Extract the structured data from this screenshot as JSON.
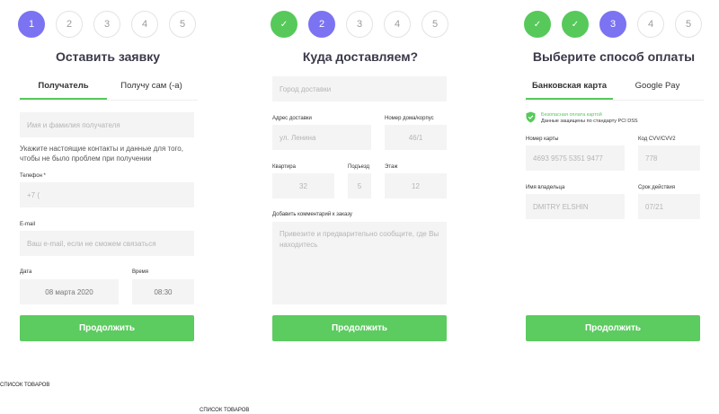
{
  "panels": [
    {
      "steps": [
        "1",
        "2",
        "3",
        "4",
        "5"
      ],
      "title": "Оставить заявку",
      "tabs": [
        "Получатель",
        "Получу сам (-а)"
      ],
      "name_placeholder": "Имя и фамилия получателя",
      "hint": "Укажите настоящие контакты и данные для того, чтобы не было проблем при получении",
      "phone_label": "Телефон *",
      "phone_value": "+7 (",
      "email_label": "E-mail",
      "email_placeholder": "Ваш e-mail, если не сможем связаться",
      "date_label": "Дата",
      "date_value": "08 марта 2020",
      "time_label": "Время",
      "time_value": "08:30",
      "button": "Продолжить"
    },
    {
      "steps": [
        "✓",
        "2",
        "3",
        "4",
        "5"
      ],
      "title": "Куда доставляем?",
      "city_placeholder": "Город доставки",
      "address_label": "Адрес доставки",
      "address_value": "ул. Ленина",
      "house_label": "Номер дома/корпус",
      "house_value": "46/1",
      "apt_label": "Квартира",
      "apt_value": "32",
      "entrance_label": "Подъезд",
      "entrance_value": "5",
      "floor_label": "Этаж",
      "floor_value": "12",
      "comment_label": "Добавить комментарий к заказу",
      "comment_placeholder": "Привезите и предварительно сообщите, где Вы находитесь",
      "button": "Продолжить"
    },
    {
      "steps": [
        "✓",
        "✓",
        "3",
        "4",
        "5"
      ],
      "title": "Выберите способ оплаты",
      "tabs": [
        "Банковская карта",
        "Google Pay"
      ],
      "secure_line1": "Безопасная оплата картой",
      "secure_line2": "Данные защищены по стандарту PCI DSS",
      "card_label": "Номер карты",
      "card_value": "4693 9575 5351 9477",
      "cvv_label": "Код CVV/CVV2",
      "cvv_value": "778",
      "holder_label": "Имя владельца",
      "holder_value": "DMITRY ELSHIN",
      "expiry_label": "Срок действия",
      "expiry_value": "07/21",
      "button": "Продолжить"
    }
  ],
  "footer": [
    "СПИСОК ТОВАРОВ",
    "СПИСОК ТОВАРОВ"
  ],
  "colors": {
    "accent": "#7b73f2",
    "success": "#56c95a",
    "field_bg": "#f4f4f4"
  }
}
